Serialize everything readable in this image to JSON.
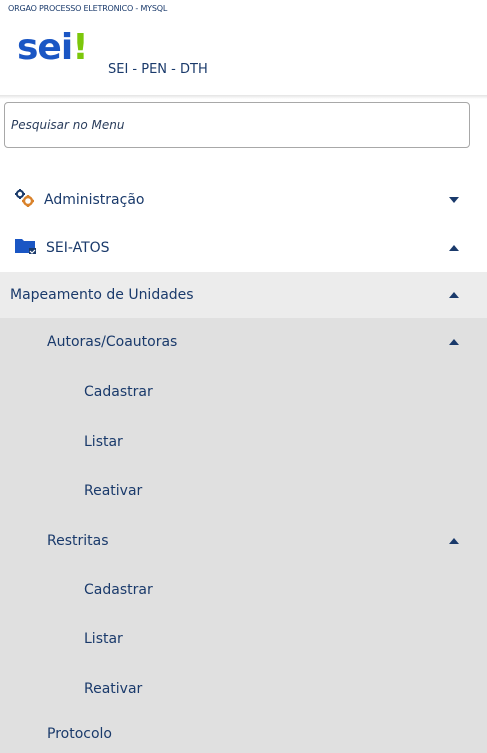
{
  "header": {
    "org_name": "ORGAO PROCESSO ELETRONICO - MYSQL",
    "logo_text": "sei",
    "logo_mark": "!",
    "system_name": "SEI - PEN - DTH"
  },
  "search": {
    "placeholder": "Pesquisar no Menu",
    "value": ""
  },
  "menu": [
    {
      "label": "Administração",
      "icon": "gears-icon",
      "expanded": false
    },
    {
      "label": "SEI-ATOS",
      "icon": "folder-icon",
      "expanded": true
    },
    {
      "label": "Mapeamento de Unidades",
      "expanded": true
    },
    {
      "label": "Autoras/Coautoras",
      "expanded": true
    },
    {
      "label": "Cadastrar"
    },
    {
      "label": "Listar"
    },
    {
      "label": "Reativar"
    },
    {
      "label": "Restritas",
      "expanded": true
    },
    {
      "label": "Cadastrar"
    },
    {
      "label": "Listar"
    },
    {
      "label": "Reativar"
    },
    {
      "label": "Protocolo"
    }
  ],
  "colors": {
    "logo": "#1a56c4",
    "logo_mark": "#7cc70b",
    "text": "#1a3a6b",
    "menu_bg": "#e0e0e0"
  }
}
